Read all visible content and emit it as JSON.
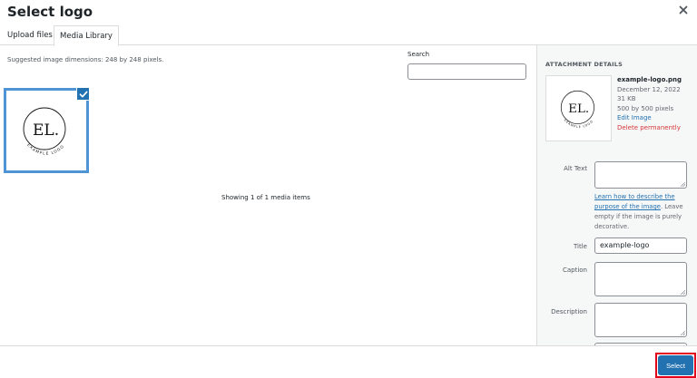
{
  "modal": {
    "title": "Select logo",
    "close_icon": "close-icon"
  },
  "tabs": [
    {
      "label": "Upload files",
      "active": false
    },
    {
      "label": "Media Library",
      "active": true
    }
  ],
  "main": {
    "hint": "Suggested image dimensions: 248 by 248 pixels.",
    "search_label": "Search",
    "search_value": "",
    "showing": "Showing 1 of 1 media items",
    "item": {
      "selected": true,
      "logo_text": "EL.",
      "logo_ring_text": "EXAMPLE LOGO"
    }
  },
  "sidebar": {
    "heading": "ATTACHMENT DETAILS",
    "filename": "example-logo.png",
    "date": "December 12, 2022",
    "size": "31 KB",
    "dimensions": "500 by 500 pixels",
    "edit_label": "Edit Image",
    "delete_label": "Delete permanently",
    "alt_text_label": "Alt Text",
    "alt_text_value": "",
    "alt_help_link": "Learn how to describe the purpose of the image",
    "alt_help_rest": ". Leave empty if the image is purely decorative.",
    "title_label": "Title",
    "title_value": "example-logo",
    "caption_label": "Caption",
    "caption_value": "",
    "description_label": "Description",
    "description_value": ""
  },
  "footer": {
    "select_label": "Select"
  },
  "colors": {
    "accent": "#2271b1",
    "danger": "#d63638",
    "highlight": "#e2001a"
  }
}
